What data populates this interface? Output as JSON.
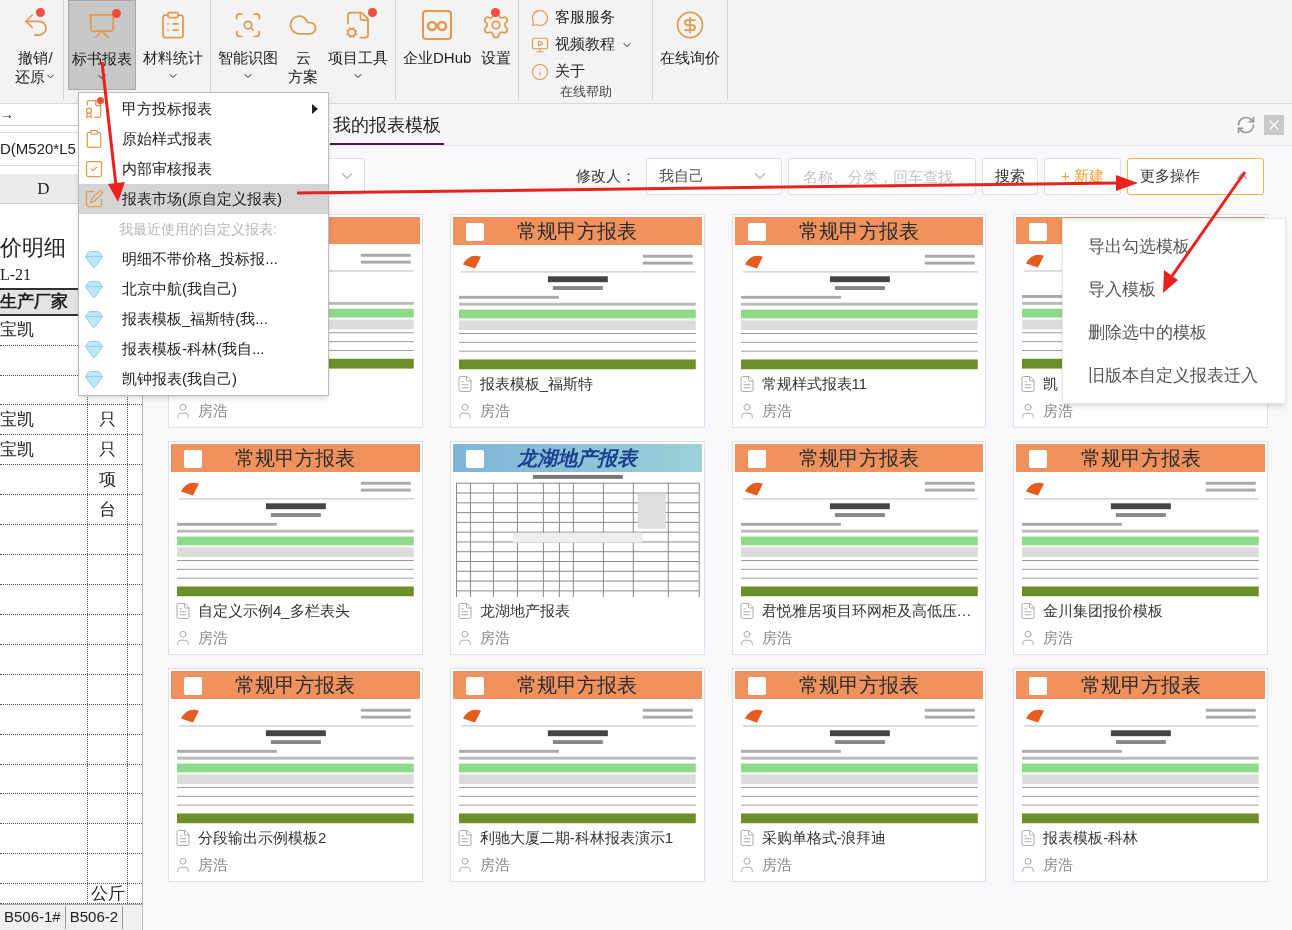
{
  "ribbon": {
    "groups": [
      [
        {
          "kind": "undo",
          "lines": [
            "撤销/",
            "还原"
          ],
          "caret": true,
          "badge": true,
          "selected": false
        }
      ],
      [
        {
          "kind": "report",
          "lines": [
            "标书报表"
          ],
          "caret": true,
          "badge": true,
          "selected": true
        },
        {
          "kind": "material",
          "lines": [
            "材料统计"
          ],
          "caret": true,
          "badge": false,
          "selected": false
        }
      ],
      [
        {
          "kind": "vision",
          "lines": [
            "智能识图"
          ],
          "caret": true,
          "badge": false,
          "selected": false
        },
        {
          "kind": "cloud",
          "lines": [
            "云",
            "方案"
          ],
          "caret": false,
          "badge": false,
          "selected": false
        },
        {
          "kind": "project",
          "lines": [
            "项目工具"
          ],
          "caret": true,
          "badge": true,
          "selected": false
        }
      ],
      [
        {
          "kind": "dhub",
          "lines": [
            "企业DHub"
          ],
          "caret": false,
          "badge": false,
          "selected": false
        },
        {
          "kind": "settings",
          "lines": [
            "设置"
          ],
          "caret": false,
          "badge": true,
          "selected": false
        }
      ],
      [
        {
          "kind": "help",
          "links": [
            {
              "kind": "chat",
              "label": "客服服务",
              "caret": false
            },
            {
              "kind": "video",
              "label": "视频教程",
              "caret": true
            },
            {
              "kind": "info",
              "label": "关于",
              "caret": false
            }
          ],
          "group_label": "在线帮助"
        }
      ],
      [
        {
          "kind": "price",
          "lines": [
            "在线询价"
          ],
          "caret": false,
          "badge": false,
          "selected": false
        }
      ]
    ]
  },
  "sheet": {
    "arrow": "→",
    "formula": "D(M520*L5",
    "column_header": "D",
    "title": "价明细",
    "code": "L-21",
    "header_cell": "生产厂家",
    "rows": [
      [
        "宝凯",
        ""
      ],
      [
        "",
        ""
      ],
      [
        "",
        ""
      ],
      [
        "宝凯",
        "只"
      ],
      [
        "宝凯",
        "只"
      ],
      [
        "",
        "项"
      ],
      [
        "",
        "台"
      ],
      [
        "",
        ""
      ],
      [
        "",
        ""
      ],
      [
        "",
        ""
      ],
      [
        "",
        ""
      ],
      [
        "",
        ""
      ],
      [
        "",
        ""
      ],
      [
        "",
        ""
      ],
      [
        "",
        ""
      ],
      [
        "",
        ""
      ],
      [
        "",
        ""
      ],
      [
        "",
        ""
      ],
      [
        "",
        ""
      ],
      [
        "",
        "公斤"
      ]
    ],
    "sheet_tabs": [
      "B506-1#",
      "B506-2"
    ]
  },
  "dialog": {
    "tab": {
      "label": "我的报表模板",
      "selected": true
    },
    "filter": {
      "modifier_label": "修改人：",
      "modifier_value": "我自己",
      "search_placeholder": "名称、分类，回车查找",
      "search_button": "搜索",
      "new_button": "+ 新建",
      "more_button": "更多操作",
      "more_expanded": true
    },
    "cards": [
      {
        "kind": "orange",
        "author": "房浩"
      },
      {
        "kind": "orange",
        "header": "常规甲方报表",
        "name": "报表模板_福斯特",
        "author": "房浩",
        "checked": false
      },
      {
        "kind": "orange",
        "header": "常规甲方报表",
        "name": "常规样式报表11",
        "author": "房浩",
        "checked": false
      },
      {
        "kind": "orange",
        "name": "凯",
        "author": "房浩",
        "checked": false
      },
      {
        "kind": "orange",
        "header": "常规甲方报表",
        "name": "自定义示例4_多栏表头",
        "author": "房浩",
        "checked": false
      },
      {
        "kind": "blue",
        "header": "龙湖地产报表",
        "name": "龙湖地产报表",
        "author": "房浩",
        "checked": false
      },
      {
        "kind": "orange",
        "header": "常规甲方报表",
        "name": "君悦雅居项目环网柜及高低压…",
        "author": "房浩",
        "checked": false
      },
      {
        "kind": "orange",
        "header": "常规甲方报表",
        "name": "金川集团报价模板",
        "author": "房浩",
        "checked": false
      },
      {
        "kind": "orange",
        "header": "常规甲方报表",
        "name": "分段输出示例模板2",
        "author": "房浩",
        "checked": false
      },
      {
        "kind": "orange",
        "header": "常规甲方报表",
        "name": "利驰大厦二期-科林报表演示1",
        "author": "房浩",
        "checked": false
      },
      {
        "kind": "orange",
        "header": "常规甲方报表",
        "name": "采购单格式-浪拜迪",
        "author": "房浩",
        "checked": false
      },
      {
        "kind": "orange",
        "header": "常规甲方报表",
        "name": "报表模板-科林",
        "author": "房浩",
        "checked": false
      }
    ],
    "more_menu": [
      "导出勾选模板",
      "导入模板",
      "删除选中的模板",
      "旧版本自定义报表迁入"
    ]
  },
  "report_menu": [
    {
      "kind": "tender",
      "label": "甲方投标报表",
      "submenu": true,
      "highlighted": false,
      "badge": true
    },
    {
      "kind": "clipboard",
      "label": "原始样式报表",
      "submenu": false,
      "highlighted": false,
      "badge": false
    },
    {
      "kind": "check",
      "label": "内部审核报表",
      "submenu": false,
      "highlighted": false,
      "badge": false
    },
    {
      "kind": "edit",
      "label": "报表市场(原自定义报表)",
      "submenu": false,
      "highlighted": true,
      "badge": false
    },
    {
      "kind": "label",
      "label": "我最近使用的自定义报表:"
    },
    {
      "kind": "diamond",
      "label": "明细不带价格_投标报...",
      "submenu": false,
      "highlighted": false,
      "badge": false
    },
    {
      "kind": "diamond",
      "label": "北京中航(我自己)",
      "submenu": false,
      "highlighted": false,
      "badge": false
    },
    {
      "kind": "diamond",
      "label": "报表模板_福斯特(我...",
      "submenu": false,
      "highlighted": false,
      "badge": false
    },
    {
      "kind": "diamond",
      "label": "报表模板-科林(我自...",
      "submenu": false,
      "highlighted": false,
      "badge": false
    },
    {
      "kind": "diamond",
      "label": "凯钟报表(我自己)",
      "submenu": false,
      "highlighted": false,
      "badge": false
    }
  ]
}
